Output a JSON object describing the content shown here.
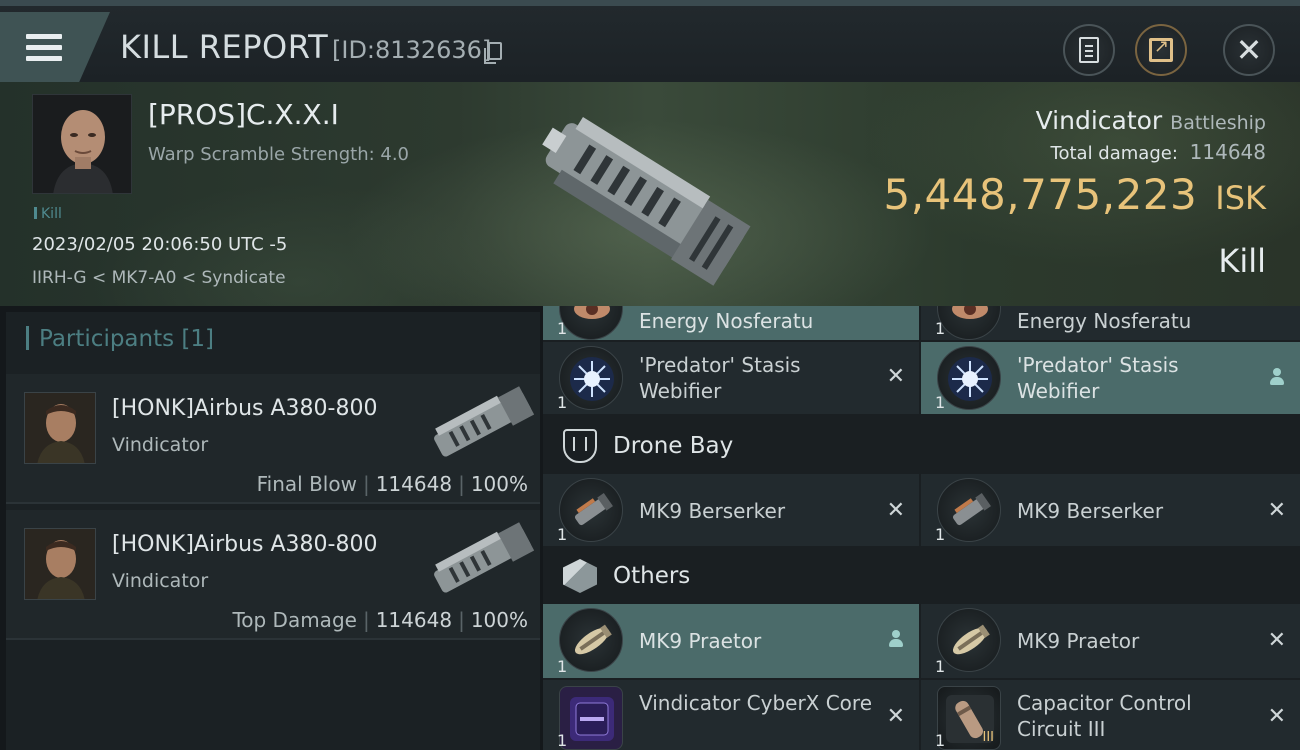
{
  "header": {
    "title": "KILL REPORT",
    "report_id": "[ID:8132636]"
  },
  "victim": {
    "name": "[PROS]C.X.X.I",
    "warp_scramble": "Warp Scramble Strength: 4.0",
    "tag": "Kill",
    "datetime": "2023/02/05 20:06:50 UTC -5",
    "location": "IIRH-G < MK7-A0 < Syndicate",
    "ship": "Vindicator",
    "ship_class": "Battleship",
    "total_damage_label": "Total damage:",
    "total_damage": "114648",
    "isk_value": "5,448,775,223",
    "isk_unit": "ISK",
    "result": "Kill"
  },
  "participants": {
    "label": "Participants [1]",
    "list": [
      {
        "name": "[HONK]Airbus A380-800",
        "ship": "Vindicator",
        "role": "Final Blow",
        "damage": "114648",
        "percent": "100%"
      },
      {
        "name": "[HONK]Airbus A380-800",
        "ship": "Vindicator",
        "role": "Top Damage",
        "damage": "114648",
        "percent": "100%"
      }
    ]
  },
  "items": {
    "row1": [
      {
        "qty": "1",
        "name": "Energy Nosferatu",
        "icon": "nosferatu-icon"
      },
      {
        "qty": "1",
        "name": "Energy Nosferatu",
        "icon": "nosferatu-icon"
      }
    ],
    "row2": [
      {
        "qty": "1",
        "name": "'Predator' Stasis Webifier",
        "icon": "webifier-icon",
        "status": "destroyed"
      },
      {
        "qty": "1",
        "name": "'Predator' Stasis Webifier",
        "icon": "webifier-icon",
        "status": "dropped"
      }
    ],
    "drone_bay_title": "Drone Bay",
    "row3": [
      {
        "qty": "1",
        "name": "MK9  Berserker",
        "icon": "berserker-drone-icon",
        "status": "destroyed"
      },
      {
        "qty": "1",
        "name": "MK9  Berserker",
        "icon": "berserker-drone-icon",
        "status": "destroyed"
      }
    ],
    "others_title": "Others",
    "row4": [
      {
        "qty": "1",
        "name": "MK9  Praetor",
        "icon": "praetor-drone-icon",
        "status": "dropped"
      },
      {
        "qty": "1",
        "name": "MK9  Praetor",
        "icon": "praetor-drone-icon",
        "status": "destroyed"
      }
    ],
    "row5": [
      {
        "qty": "1",
        "name": "Vindicator CyberX Core",
        "icon": "cyberx-core-icon",
        "status": "destroyed"
      },
      {
        "qty": "1",
        "name": "Capacitor Control Circuit III",
        "icon": "rig-icon",
        "tier": "III",
        "status": "destroyed"
      }
    ]
  },
  "colors": {
    "accent_teal": "#4c7e82",
    "highlight_row": "#4b6b6a",
    "isk_gold": "#e8c37a"
  }
}
